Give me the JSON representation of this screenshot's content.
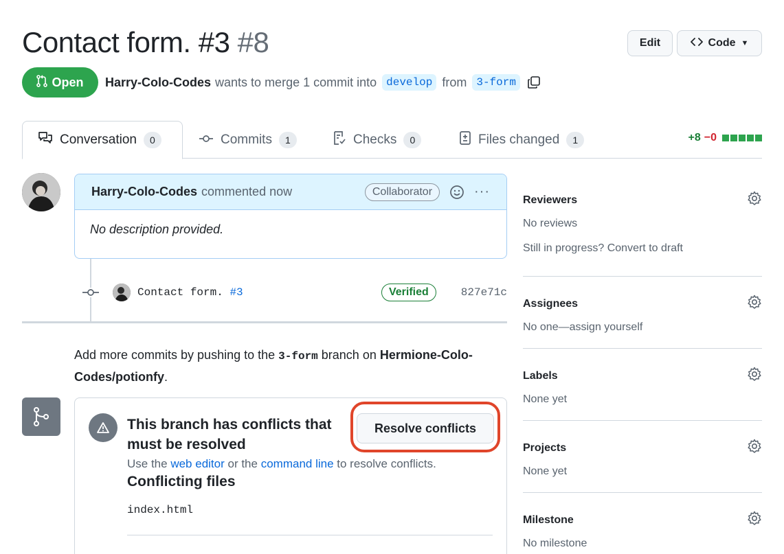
{
  "header": {
    "title": "Contact form. #3",
    "number": "#8",
    "edit_label": "Edit",
    "code_label": "Code"
  },
  "status": {
    "state": "Open",
    "author": "Harry-Colo-Codes",
    "action_text": "wants to merge 1 commit into",
    "base_branch": "develop",
    "from_text": "from",
    "head_branch": "3-form"
  },
  "tabs": [
    {
      "label": "Conversation",
      "count": "0",
      "icon": "comment-discussion-icon"
    },
    {
      "label": "Commits",
      "count": "1",
      "icon": "git-commit-icon"
    },
    {
      "label": "Checks",
      "count": "0",
      "icon": "checklist-icon"
    },
    {
      "label": "Files changed",
      "count": "1",
      "icon": "file-diff-icon"
    }
  ],
  "diffstat": {
    "additions": "+8",
    "deletions": "−0"
  },
  "comment": {
    "author": "Harry-Colo-Codes",
    "time_text": "commented now",
    "role": "Collaborator",
    "body": "No description provided."
  },
  "commit": {
    "message": "Contact form.",
    "ref": "#3",
    "verified": "Verified",
    "sha": "827e71c"
  },
  "push_hint": {
    "pre": "Add more commits by pushing to the",
    "branch": "3-form",
    "mid": "branch on",
    "repo": "Hermione-Colo-Codes/potionfy",
    "post": "."
  },
  "merge_box": {
    "title": "This branch has conflicts that must be resolved",
    "sub_pre": "Use the",
    "web_editor": "web editor",
    "sub_or": "or the",
    "command_line": "command line",
    "sub_post": "to resolve conflicts.",
    "conflicting_heading": "Conflicting files",
    "file": "index.html",
    "resolve_label": "Resolve conflicts"
  },
  "sidebar": {
    "reviewers": {
      "heading": "Reviewers",
      "value": "No reviews",
      "extra": "Still in progress? Convert to draft"
    },
    "assignees": {
      "heading": "Assignees",
      "value": "No one—assign yourself"
    },
    "labels": {
      "heading": "Labels",
      "value": "None yet"
    },
    "projects": {
      "heading": "Projects",
      "value": "None yet"
    },
    "milestone": {
      "heading": "Milestone",
      "value": "No milestone"
    }
  },
  "colors": {
    "open_green": "#2da44e",
    "link_blue": "#0969da",
    "highlight_red": "#e0452a"
  }
}
